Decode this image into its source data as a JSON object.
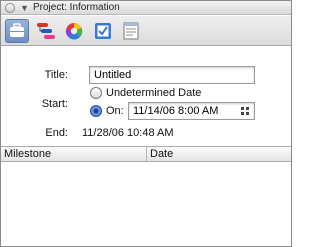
{
  "window": {
    "title": "Project: Information",
    "disclosure_glyph": "▼"
  },
  "toolbar": {
    "buttons": [
      {
        "icon": "briefcase-icon",
        "selected": true
      },
      {
        "icon": "gantt-icon",
        "selected": false
      },
      {
        "icon": "color-wheel-icon",
        "selected": false
      },
      {
        "icon": "checklist-icon",
        "selected": false
      },
      {
        "icon": "notes-icon",
        "selected": false
      }
    ]
  },
  "form": {
    "title_label": "Title:",
    "title_value": "Untitled",
    "start_label": "Start:",
    "start_option_undetermined": "Undetermined Date",
    "start_option_on": "On:",
    "start_selected": "on",
    "start_value": "11/14/06 8:00 AM",
    "end_label": "End:",
    "end_value": "11/28/06 10:48 AM"
  },
  "milestones_table": {
    "columns": [
      "Milestone",
      "Date"
    ],
    "rows": []
  },
  "colors": {
    "selected_toolbar_bg": "#7f9dcf",
    "radio_selected": "#3a6fd6"
  }
}
